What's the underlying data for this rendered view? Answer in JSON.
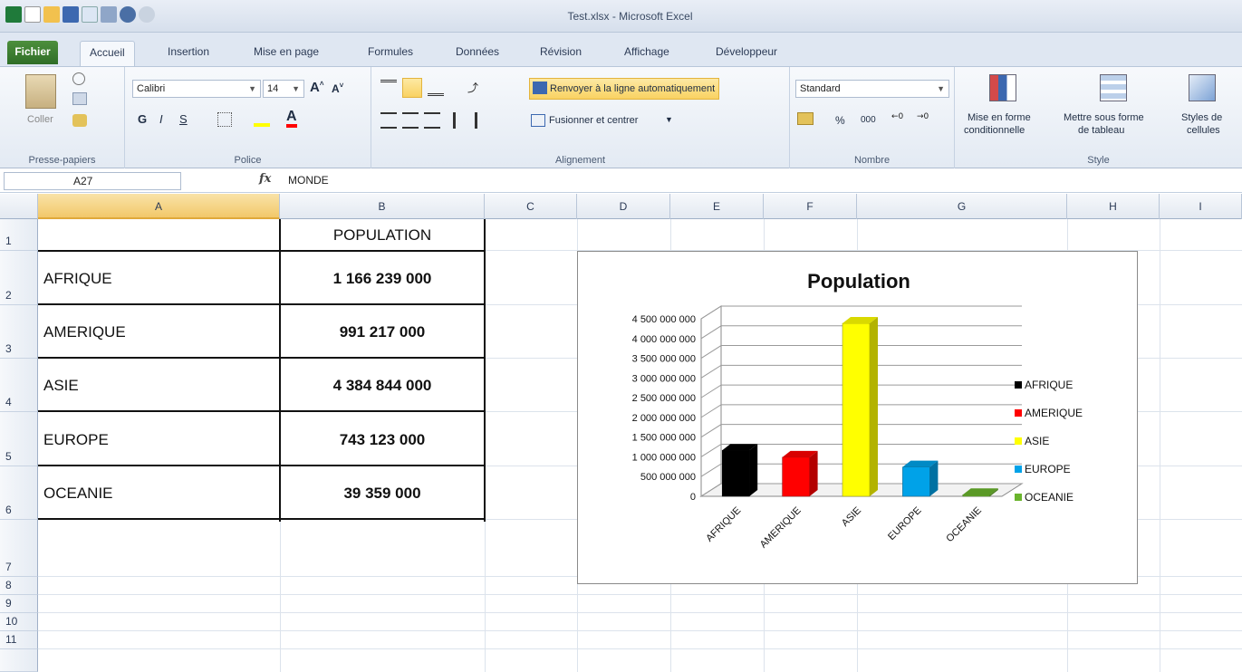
{
  "window": {
    "title": "Test.xlsx - Microsoft Excel"
  },
  "tabs": [
    {
      "label": "Fichier"
    },
    {
      "label": "Accueil"
    },
    {
      "label": "Insertion"
    },
    {
      "label": "Mise en page"
    },
    {
      "label": "Formules"
    },
    {
      "label": "Données"
    },
    {
      "label": "Révision"
    },
    {
      "label": "Affichage"
    },
    {
      "label": "Développeur"
    }
  ],
  "ribbon": {
    "clipboard": {
      "paste_label": "Coller",
      "group_label": "Presse-papiers"
    },
    "font": {
      "font_name": "Calibri",
      "font_size": "14",
      "group_label": "Police",
      "bold": "G",
      "italic": "I",
      "underline": "S",
      "font_color_label": "A"
    },
    "alignment": {
      "wrap_text": "Renvoyer à la ligne automatiquement",
      "merge_center": "Fusionner et centrer",
      "group_label": "Alignement"
    },
    "number": {
      "format": "Standard",
      "percent": "%",
      "thousands": "000",
      "group_label": "Nombre"
    },
    "style": {
      "conditional_1": "Mise en forme",
      "conditional_2": "conditionnelle",
      "table_1": "Mettre sous forme",
      "table_2": "de tableau",
      "cell_styles_1": "Styles de",
      "cell_styles_2": "cellules",
      "group_label": "Style"
    }
  },
  "formula_bar": {
    "name_box": "A27",
    "fx": "fx",
    "value": "MONDE"
  },
  "columns": [
    "A",
    "B",
    "C",
    "D",
    "E",
    "F",
    "G",
    "H",
    "I"
  ],
  "rows": [
    "1",
    "2",
    "3",
    "4",
    "5",
    "6",
    "7",
    "8",
    "9",
    "10",
    "11"
  ],
  "table": {
    "header": "POPULATION",
    "rows": [
      {
        "region": "AFRIQUE",
        "population": "1 166 239 000"
      },
      {
        "region": "AMERIQUE",
        "population": "991 217 000"
      },
      {
        "region": "ASIE",
        "population": "4 384 844 000"
      },
      {
        "region": "EUROPE",
        "population": "743 123 000"
      },
      {
        "region": "OCEANIE",
        "population": "39 359 000"
      }
    ]
  },
  "chart_data": {
    "type": "bar",
    "title": "Population",
    "categories": [
      "AFRIQUE",
      "AMERIQUE",
      "ASIE",
      "EUROPE",
      "OCEANIE"
    ],
    "values": [
      1166239000,
      991217000,
      4384844000,
      743123000,
      39359000
    ],
    "colors": [
      "#000000",
      "#ff0000",
      "#ffff00",
      "#00a2e8",
      "#6ab42d"
    ],
    "ylim": [
      0,
      4500000000
    ],
    "yticks": [
      "0",
      "500 000 000",
      "1 000 000 000",
      "1 500 000 000",
      "2 000 000 000",
      "2 500 000 000",
      "3 000 000 000",
      "3 500 000 000",
      "4 000 000 000",
      "4 500 000 000"
    ],
    "legend": [
      "AFRIQUE",
      "AMERIQUE",
      "ASIE",
      "EUROPE",
      "OCEANIE"
    ],
    "legend_position": "right",
    "grid": true,
    "style": "3d-column"
  }
}
